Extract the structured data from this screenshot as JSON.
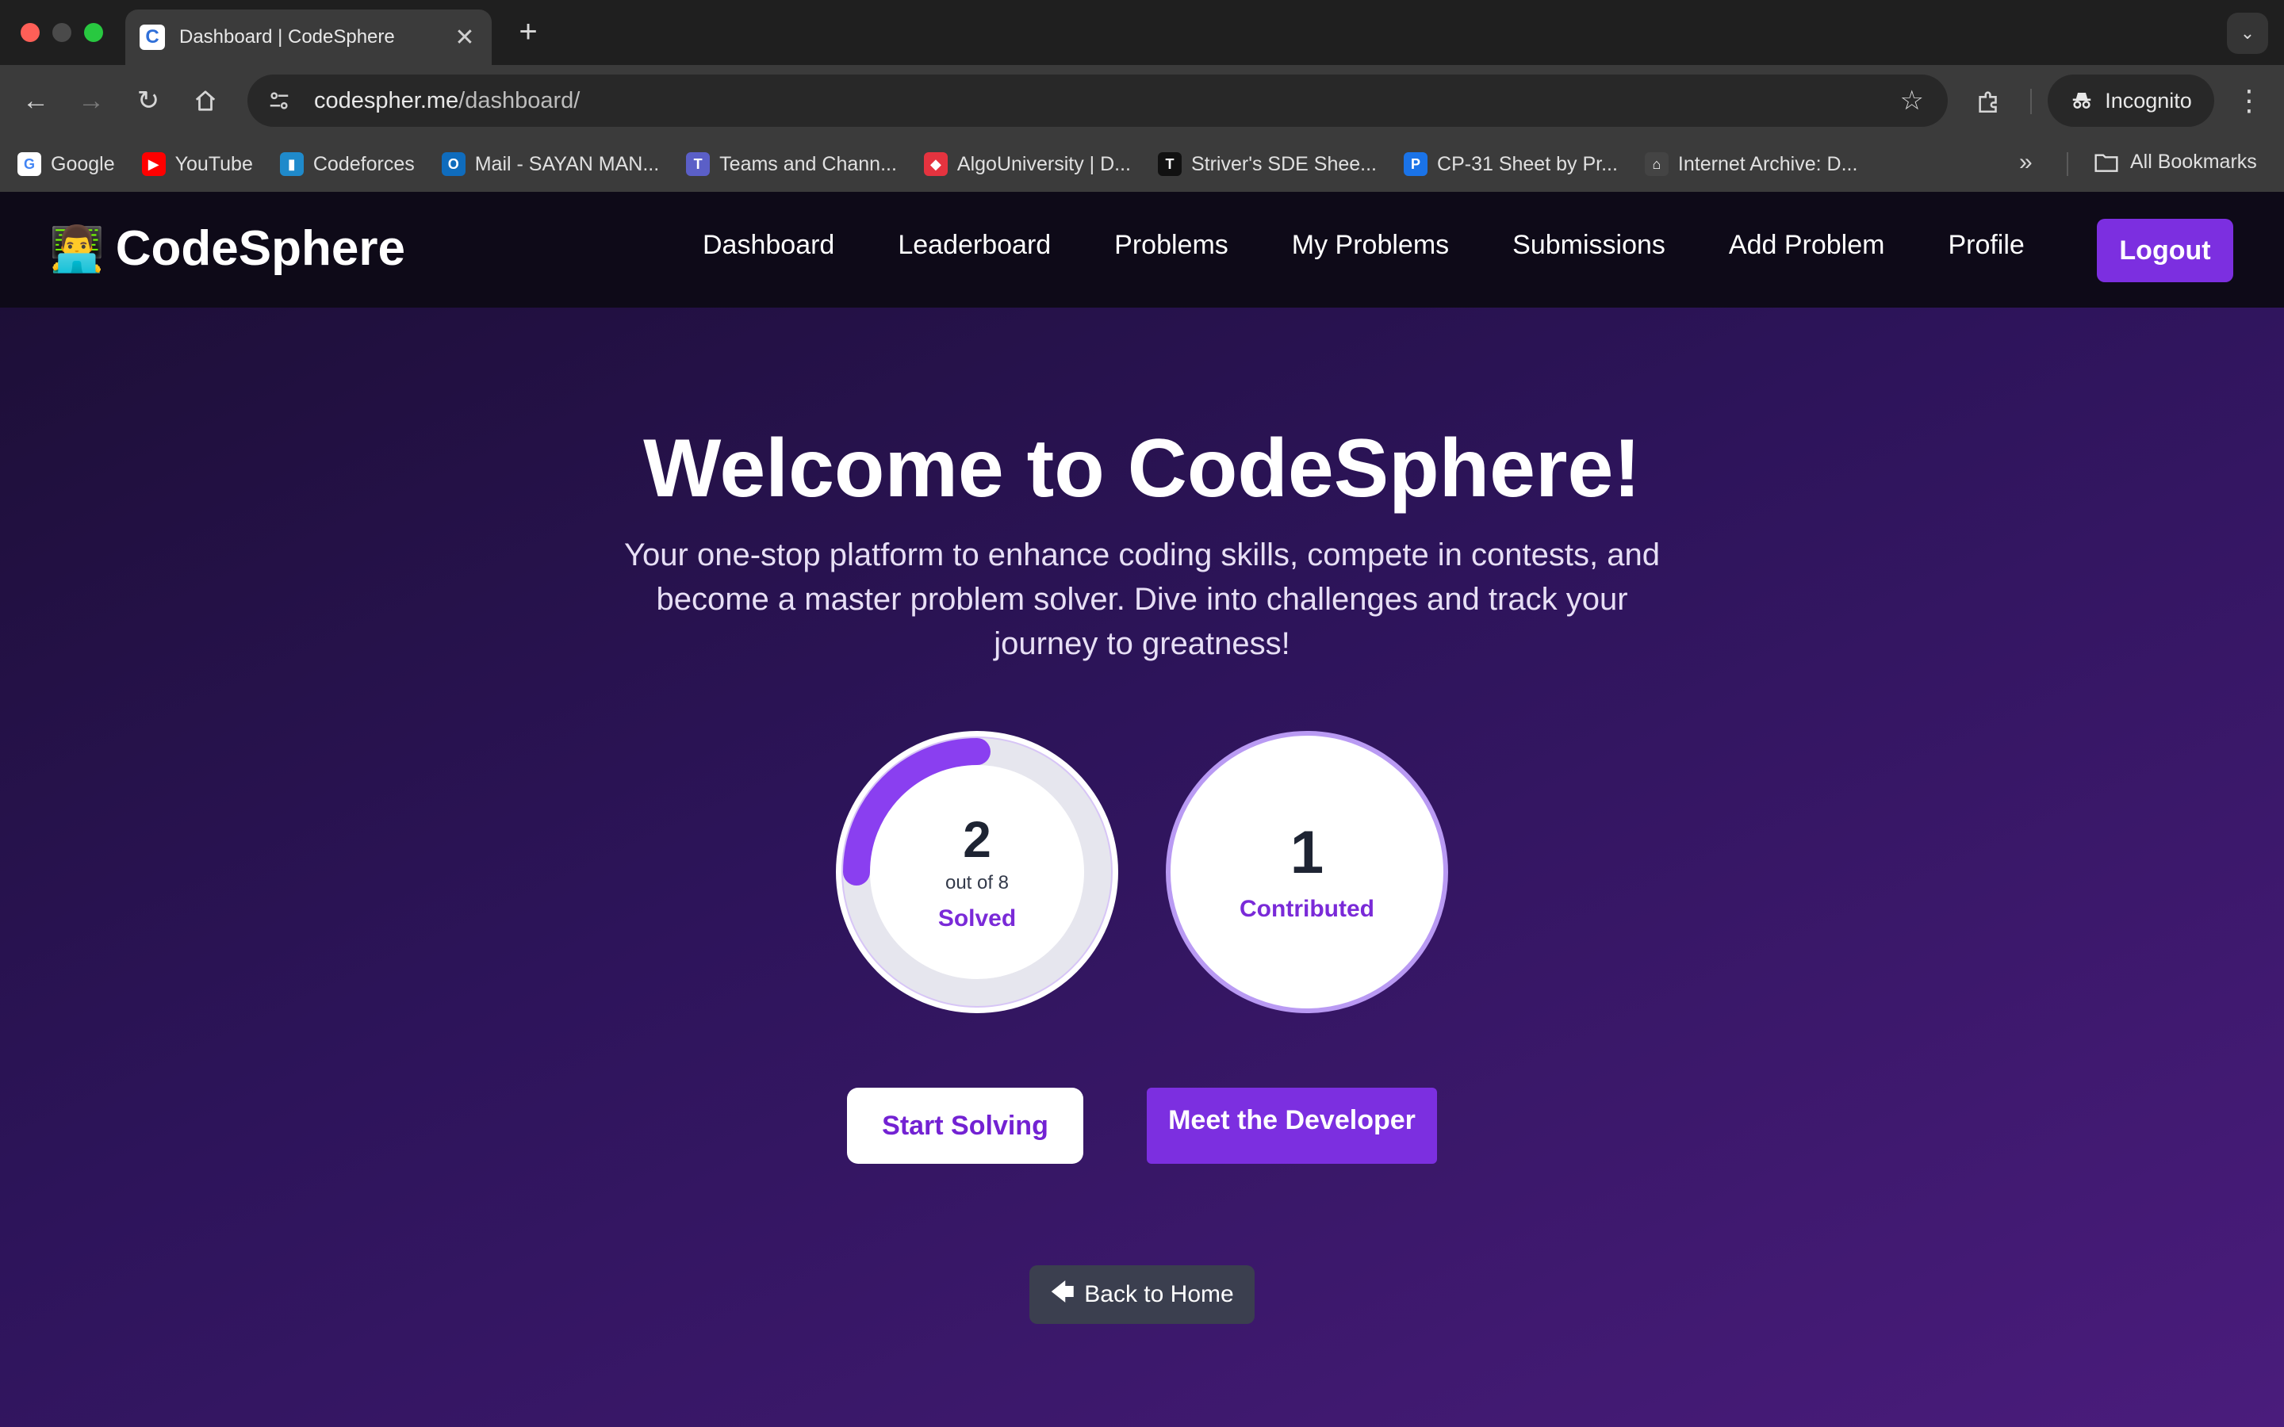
{
  "browser": {
    "tab_title": "Dashboard | CodeSphere",
    "tab_favicon_letter": "C",
    "url_host": "codespher.me",
    "url_path": "/dashboard/",
    "incognito_label": "Incognito",
    "bookmarks": [
      {
        "label": "Google",
        "icon": "google-icon",
        "color": "#ffffff",
        "glyph": "G"
      },
      {
        "label": "YouTube",
        "icon": "youtube-icon",
        "color": "#ff0000",
        "glyph": "▶"
      },
      {
        "label": "Codeforces",
        "icon": "codeforces-icon",
        "color": "#1f8acb",
        "glyph": "▮"
      },
      {
        "label": "Mail - SAYAN MAN...",
        "icon": "outlook-icon",
        "color": "#0f6cbd",
        "glyph": "O"
      },
      {
        "label": "Teams and Chann...",
        "icon": "teams-icon",
        "color": "#5b5fc7",
        "glyph": "T"
      },
      {
        "label": "AlgoUniversity | D...",
        "icon": "algouniversity-icon",
        "color": "#e5333f",
        "glyph": "◆"
      },
      {
        "label": "Striver's SDE Shee...",
        "icon": "tuf-icon",
        "color": "#111111",
        "glyph": "T"
      },
      {
        "label": "CP-31 Sheet by Pr...",
        "icon": "cp31-icon",
        "color": "#1a73e8",
        "glyph": "P"
      },
      {
        "label": "Internet Archive: D...",
        "icon": "archive-icon",
        "color": "#444444",
        "glyph": "⌂"
      }
    ],
    "all_bookmarks_label": "All Bookmarks"
  },
  "navbar": {
    "brand_emoji": "👨‍💻",
    "brand_name": "CodeSphere",
    "links": [
      "Dashboard",
      "Leaderboard",
      "Problems",
      "My Problems",
      "Submissions",
      "Add Problem",
      "Profile"
    ],
    "logout_label": "Logout"
  },
  "hero": {
    "title": "Welcome to CodeSphere!",
    "subtitle": "Your one-stop platform to enhance coding skills, compete in contests, and become a master problem solver. Dive into challenges and track your journey to greatness!"
  },
  "stats": {
    "solved": {
      "value": "2",
      "total_text": "out of 8",
      "label": "Solved",
      "fraction": 0.25
    },
    "contributed": {
      "value": "1",
      "label": "Contributed"
    }
  },
  "actions": {
    "start_solving": "Start Solving",
    "meet_developer": "Meet the Developer",
    "back_home": "Back to Home"
  },
  "colors": {
    "accent": "#7c2fe0",
    "ring_track": "#e6e6ee",
    "ring_progress": "#8a3ff0"
  }
}
